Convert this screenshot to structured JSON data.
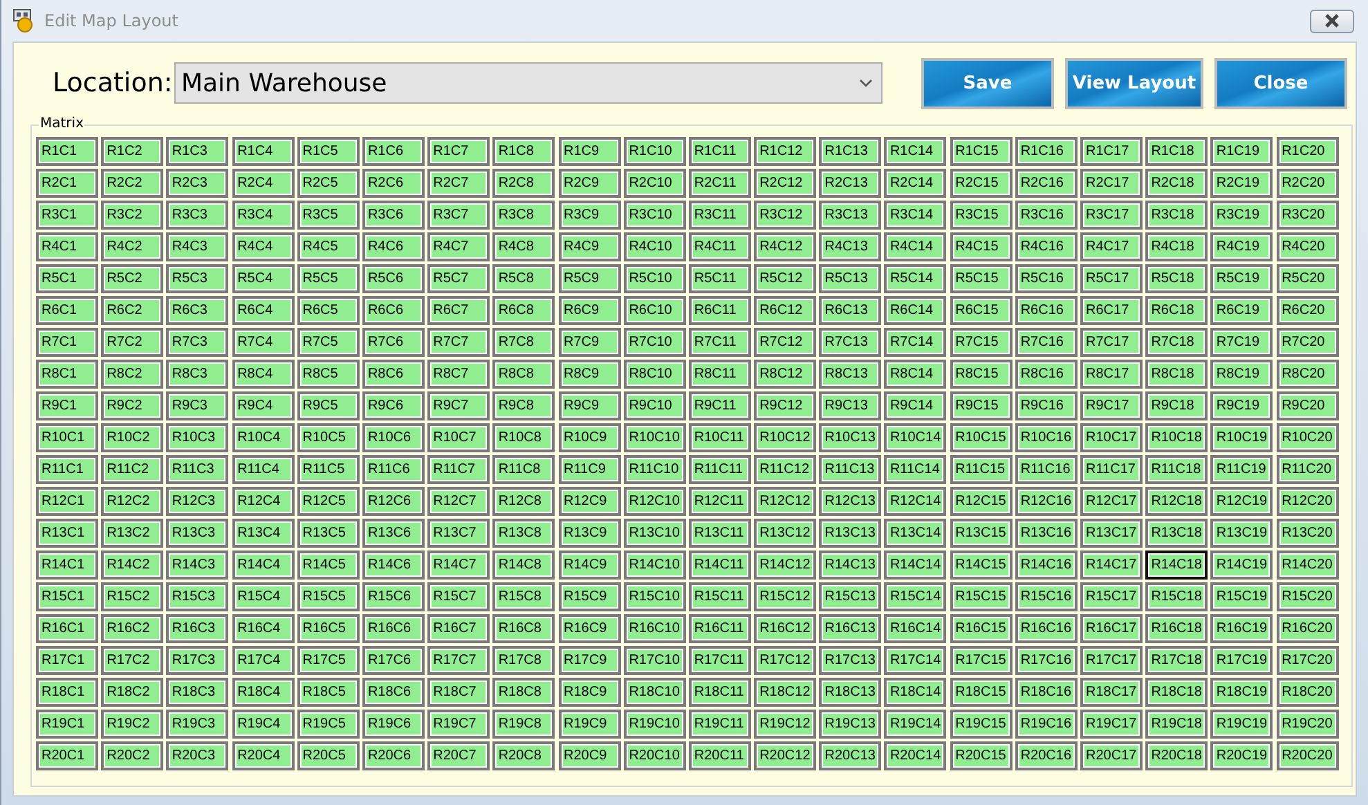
{
  "window": {
    "title": "Edit Map Layout"
  },
  "location": {
    "label": "Location:",
    "value": "Main Warehouse"
  },
  "buttons": [
    "Save",
    "View Layout",
    "Close"
  ],
  "matrix": {
    "title": "Matrix",
    "rows": [
      {
        "cells": [
          {
            "label": "R1C1",
            "focused": false
          },
          {
            "label": "R1C2",
            "focused": false
          },
          {
            "label": "R1C3",
            "focused": false
          },
          {
            "label": "R1C4",
            "focused": false
          },
          {
            "label": "R1C5",
            "focused": false
          },
          {
            "label": "R1C6",
            "focused": false
          },
          {
            "label": "R1C7",
            "focused": false
          },
          {
            "label": "R1C8",
            "focused": false
          },
          {
            "label": "R1C9",
            "focused": false
          },
          {
            "label": "R1C10",
            "focused": false
          },
          {
            "label": "R1C11",
            "focused": false
          },
          {
            "label": "R1C12",
            "focused": false
          },
          {
            "label": "R1C13",
            "focused": false
          },
          {
            "label": "R1C14",
            "focused": false
          },
          {
            "label": "R1C15",
            "focused": false
          },
          {
            "label": "R1C16",
            "focused": false
          },
          {
            "label": "R1C17",
            "focused": false
          },
          {
            "label": "R1C18",
            "focused": false
          },
          {
            "label": "R1C19",
            "focused": false
          },
          {
            "label": "R1C20",
            "focused": false
          }
        ]
      },
      {
        "cells": [
          {
            "label": "R2C1",
            "focused": false
          },
          {
            "label": "R2C2",
            "focused": false
          },
          {
            "label": "R2C3",
            "focused": false
          },
          {
            "label": "R2C4",
            "focused": false
          },
          {
            "label": "R2C5",
            "focused": false
          },
          {
            "label": "R2C6",
            "focused": false
          },
          {
            "label": "R2C7",
            "focused": false
          },
          {
            "label": "R2C8",
            "focused": false
          },
          {
            "label": "R2C9",
            "focused": false
          },
          {
            "label": "R2C10",
            "focused": false
          },
          {
            "label": "R2C11",
            "focused": false
          },
          {
            "label": "R2C12",
            "focused": false
          },
          {
            "label": "R2C13",
            "focused": false
          },
          {
            "label": "R2C14",
            "focused": false
          },
          {
            "label": "R2C15",
            "focused": false
          },
          {
            "label": "R2C16",
            "focused": false
          },
          {
            "label": "R2C17",
            "focused": false
          },
          {
            "label": "R2C18",
            "focused": false
          },
          {
            "label": "R2C19",
            "focused": false
          },
          {
            "label": "R2C20",
            "focused": false
          }
        ]
      },
      {
        "cells": [
          {
            "label": "R3C1",
            "focused": false
          },
          {
            "label": "R3C2",
            "focused": false
          },
          {
            "label": "R3C3",
            "focused": false
          },
          {
            "label": "R3C4",
            "focused": false
          },
          {
            "label": "R3C5",
            "focused": false
          },
          {
            "label": "R3C6",
            "focused": false
          },
          {
            "label": "R3C7",
            "focused": false
          },
          {
            "label": "R3C8",
            "focused": false
          },
          {
            "label": "R3C9",
            "focused": false
          },
          {
            "label": "R3C10",
            "focused": false
          },
          {
            "label": "R3C11",
            "focused": false
          },
          {
            "label": "R3C12",
            "focused": false
          },
          {
            "label": "R3C13",
            "focused": false
          },
          {
            "label": "R3C14",
            "focused": false
          },
          {
            "label": "R3C15",
            "focused": false
          },
          {
            "label": "R3C16",
            "focused": false
          },
          {
            "label": "R3C17",
            "focused": false
          },
          {
            "label": "R3C18",
            "focused": false
          },
          {
            "label": "R3C19",
            "focused": false
          },
          {
            "label": "R3C20",
            "focused": false
          }
        ]
      },
      {
        "cells": [
          {
            "label": "R4C1",
            "focused": false
          },
          {
            "label": "R4C2",
            "focused": false
          },
          {
            "label": "R4C3",
            "focused": false
          },
          {
            "label": "R4C4",
            "focused": false
          },
          {
            "label": "R4C5",
            "focused": false
          },
          {
            "label": "R4C6",
            "focused": false
          },
          {
            "label": "R4C7",
            "focused": false
          },
          {
            "label": "R4C8",
            "focused": false
          },
          {
            "label": "R4C9",
            "focused": false
          },
          {
            "label": "R4C10",
            "focused": false
          },
          {
            "label": "R4C11",
            "focused": false
          },
          {
            "label": "R4C12",
            "focused": false
          },
          {
            "label": "R4C13",
            "focused": false
          },
          {
            "label": "R4C14",
            "focused": false
          },
          {
            "label": "R4C15",
            "focused": false
          },
          {
            "label": "R4C16",
            "focused": false
          },
          {
            "label": "R4C17",
            "focused": false
          },
          {
            "label": "R4C18",
            "focused": false
          },
          {
            "label": "R4C19",
            "focused": false
          },
          {
            "label": "R4C20",
            "focused": false
          }
        ]
      },
      {
        "cells": [
          {
            "label": "R5C1",
            "focused": false
          },
          {
            "label": "R5C2",
            "focused": false
          },
          {
            "label": "R5C3",
            "focused": false
          },
          {
            "label": "R5C4",
            "focused": false
          },
          {
            "label": "R5C5",
            "focused": false
          },
          {
            "label": "R5C6",
            "focused": false
          },
          {
            "label": "R5C7",
            "focused": false
          },
          {
            "label": "R5C8",
            "focused": false
          },
          {
            "label": "R5C9",
            "focused": false
          },
          {
            "label": "R5C10",
            "focused": false
          },
          {
            "label": "R5C11",
            "focused": false
          },
          {
            "label": "R5C12",
            "focused": false
          },
          {
            "label": "R5C13",
            "focused": false
          },
          {
            "label": "R5C14",
            "focused": false
          },
          {
            "label": "R5C15",
            "focused": false
          },
          {
            "label": "R5C16",
            "focused": false
          },
          {
            "label": "R5C17",
            "focused": false
          },
          {
            "label": "R5C18",
            "focused": false
          },
          {
            "label": "R5C19",
            "focused": false
          },
          {
            "label": "R5C20",
            "focused": false
          }
        ]
      },
      {
        "cells": [
          {
            "label": "R6C1",
            "focused": false
          },
          {
            "label": "R6C2",
            "focused": false
          },
          {
            "label": "R6C3",
            "focused": false
          },
          {
            "label": "R6C4",
            "focused": false
          },
          {
            "label": "R6C5",
            "focused": false
          },
          {
            "label": "R6C6",
            "focused": false
          },
          {
            "label": "R6C7",
            "focused": false
          },
          {
            "label": "R6C8",
            "focused": false
          },
          {
            "label": "R6C9",
            "focused": false
          },
          {
            "label": "R6C10",
            "focused": false
          },
          {
            "label": "R6C11",
            "focused": false
          },
          {
            "label": "R6C12",
            "focused": false
          },
          {
            "label": "R6C13",
            "focused": false
          },
          {
            "label": "R6C14",
            "focused": false
          },
          {
            "label": "R6C15",
            "focused": false
          },
          {
            "label": "R6C16",
            "focused": false
          },
          {
            "label": "R6C17",
            "focused": false
          },
          {
            "label": "R6C18",
            "focused": false
          },
          {
            "label": "R6C19",
            "focused": false
          },
          {
            "label": "R6C20",
            "focused": false
          }
        ]
      },
      {
        "cells": [
          {
            "label": "R7C1",
            "focused": false
          },
          {
            "label": "R7C2",
            "focused": false
          },
          {
            "label": "R7C3",
            "focused": false
          },
          {
            "label": "R7C4",
            "focused": false
          },
          {
            "label": "R7C5",
            "focused": false
          },
          {
            "label": "R7C6",
            "focused": false
          },
          {
            "label": "R7C7",
            "focused": false
          },
          {
            "label": "R7C8",
            "focused": false
          },
          {
            "label": "R7C9",
            "focused": false
          },
          {
            "label": "R7C10",
            "focused": false
          },
          {
            "label": "R7C11",
            "focused": false
          },
          {
            "label": "R7C12",
            "focused": false
          },
          {
            "label": "R7C13",
            "focused": false
          },
          {
            "label": "R7C14",
            "focused": false
          },
          {
            "label": "R7C15",
            "focused": false
          },
          {
            "label": "R7C16",
            "focused": false
          },
          {
            "label": "R7C17",
            "focused": false
          },
          {
            "label": "R7C18",
            "focused": false
          },
          {
            "label": "R7C19",
            "focused": false
          },
          {
            "label": "R7C20",
            "focused": false
          }
        ]
      },
      {
        "cells": [
          {
            "label": "R8C1",
            "focused": false
          },
          {
            "label": "R8C2",
            "focused": false
          },
          {
            "label": "R8C3",
            "focused": false
          },
          {
            "label": "R8C4",
            "focused": false
          },
          {
            "label": "R8C5",
            "focused": false
          },
          {
            "label": "R8C6",
            "focused": false
          },
          {
            "label": "R8C7",
            "focused": false
          },
          {
            "label": "R8C8",
            "focused": false
          },
          {
            "label": "R8C9",
            "focused": false
          },
          {
            "label": "R8C10",
            "focused": false
          },
          {
            "label": "R8C11",
            "focused": false
          },
          {
            "label": "R8C12",
            "focused": false
          },
          {
            "label": "R8C13",
            "focused": false
          },
          {
            "label": "R8C14",
            "focused": false
          },
          {
            "label": "R8C15",
            "focused": false
          },
          {
            "label": "R8C16",
            "focused": false
          },
          {
            "label": "R8C17",
            "focused": false
          },
          {
            "label": "R8C18",
            "focused": false
          },
          {
            "label": "R8C19",
            "focused": false
          },
          {
            "label": "R8C20",
            "focused": false
          }
        ]
      },
      {
        "cells": [
          {
            "label": "R9C1",
            "focused": false
          },
          {
            "label": "R9C2",
            "focused": false
          },
          {
            "label": "R9C3",
            "focused": false
          },
          {
            "label": "R9C4",
            "focused": false
          },
          {
            "label": "R9C5",
            "focused": false
          },
          {
            "label": "R9C6",
            "focused": false
          },
          {
            "label": "R9C7",
            "focused": false
          },
          {
            "label": "R9C8",
            "focused": false
          },
          {
            "label": "R9C9",
            "focused": false
          },
          {
            "label": "R9C10",
            "focused": false
          },
          {
            "label": "R9C11",
            "focused": false
          },
          {
            "label": "R9C12",
            "focused": false
          },
          {
            "label": "R9C13",
            "focused": false
          },
          {
            "label": "R9C14",
            "focused": false
          },
          {
            "label": "R9C15",
            "focused": false
          },
          {
            "label": "R9C16",
            "focused": false
          },
          {
            "label": "R9C17",
            "focused": false
          },
          {
            "label": "R9C18",
            "focused": false
          },
          {
            "label": "R9C19",
            "focused": false
          },
          {
            "label": "R9C20",
            "focused": false
          }
        ]
      },
      {
        "cells": [
          {
            "label": "R10C1",
            "focused": false
          },
          {
            "label": "R10C2",
            "focused": false
          },
          {
            "label": "R10C3",
            "focused": false
          },
          {
            "label": "R10C4",
            "focused": false
          },
          {
            "label": "R10C5",
            "focused": false
          },
          {
            "label": "R10C6",
            "focused": false
          },
          {
            "label": "R10C7",
            "focused": false
          },
          {
            "label": "R10C8",
            "focused": false
          },
          {
            "label": "R10C9",
            "focused": false
          },
          {
            "label": "R10C10",
            "focused": false
          },
          {
            "label": "R10C11",
            "focused": false
          },
          {
            "label": "R10C12",
            "focused": false
          },
          {
            "label": "R10C13",
            "focused": false
          },
          {
            "label": "R10C14",
            "focused": false
          },
          {
            "label": "R10C15",
            "focused": false
          },
          {
            "label": "R10C16",
            "focused": false
          },
          {
            "label": "R10C17",
            "focused": false
          },
          {
            "label": "R10C18",
            "focused": false
          },
          {
            "label": "R10C19",
            "focused": false
          },
          {
            "label": "R10C20",
            "focused": false
          }
        ]
      },
      {
        "cells": [
          {
            "label": "R11C1",
            "focused": false
          },
          {
            "label": "R11C2",
            "focused": false
          },
          {
            "label": "R11C3",
            "focused": false
          },
          {
            "label": "R11C4",
            "focused": false
          },
          {
            "label": "R11C5",
            "focused": false
          },
          {
            "label": "R11C6",
            "focused": false
          },
          {
            "label": "R11C7",
            "focused": false
          },
          {
            "label": "R11C8",
            "focused": false
          },
          {
            "label": "R11C9",
            "focused": false
          },
          {
            "label": "R11C10",
            "focused": false
          },
          {
            "label": "R11C11",
            "focused": false
          },
          {
            "label": "R11C12",
            "focused": false
          },
          {
            "label": "R11C13",
            "focused": false
          },
          {
            "label": "R11C14",
            "focused": false
          },
          {
            "label": "R11C15",
            "focused": false
          },
          {
            "label": "R11C16",
            "focused": false
          },
          {
            "label": "R11C17",
            "focused": false
          },
          {
            "label": "R11C18",
            "focused": false
          },
          {
            "label": "R11C19",
            "focused": false
          },
          {
            "label": "R11C20",
            "focused": false
          }
        ]
      },
      {
        "cells": [
          {
            "label": "R12C1",
            "focused": false
          },
          {
            "label": "R12C2",
            "focused": false
          },
          {
            "label": "R12C3",
            "focused": false
          },
          {
            "label": "R12C4",
            "focused": false
          },
          {
            "label": "R12C5",
            "focused": false
          },
          {
            "label": "R12C6",
            "focused": false
          },
          {
            "label": "R12C7",
            "focused": false
          },
          {
            "label": "R12C8",
            "focused": false
          },
          {
            "label": "R12C9",
            "focused": false
          },
          {
            "label": "R12C10",
            "focused": false
          },
          {
            "label": "R12C11",
            "focused": false
          },
          {
            "label": "R12C12",
            "focused": false
          },
          {
            "label": "R12C13",
            "focused": false
          },
          {
            "label": "R12C14",
            "focused": false
          },
          {
            "label": "R12C15",
            "focused": false
          },
          {
            "label": "R12C16",
            "focused": false
          },
          {
            "label": "R12C17",
            "focused": false
          },
          {
            "label": "R12C18",
            "focused": false
          },
          {
            "label": "R12C19",
            "focused": false
          },
          {
            "label": "R12C20",
            "focused": false
          }
        ]
      },
      {
        "cells": [
          {
            "label": "R13C1",
            "focused": false
          },
          {
            "label": "R13C2",
            "focused": false
          },
          {
            "label": "R13C3",
            "focused": false
          },
          {
            "label": "R13C4",
            "focused": false
          },
          {
            "label": "R13C5",
            "focused": false
          },
          {
            "label": "R13C6",
            "focused": false
          },
          {
            "label": "R13C7",
            "focused": false
          },
          {
            "label": "R13C8",
            "focused": false
          },
          {
            "label": "R13C9",
            "focused": false
          },
          {
            "label": "R13C10",
            "focused": false
          },
          {
            "label": "R13C11",
            "focused": false
          },
          {
            "label": "R13C12",
            "focused": false
          },
          {
            "label": "R13C13",
            "focused": false
          },
          {
            "label": "R13C14",
            "focused": false
          },
          {
            "label": "R13C15",
            "focused": false
          },
          {
            "label": "R13C16",
            "focused": false
          },
          {
            "label": "R13C17",
            "focused": false
          },
          {
            "label": "R13C18",
            "focused": false
          },
          {
            "label": "R13C19",
            "focused": false
          },
          {
            "label": "R13C20",
            "focused": false
          }
        ]
      },
      {
        "cells": [
          {
            "label": "R14C1",
            "focused": false
          },
          {
            "label": "R14C2",
            "focused": false
          },
          {
            "label": "R14C3",
            "focused": false
          },
          {
            "label": "R14C4",
            "focused": false
          },
          {
            "label": "R14C5",
            "focused": false
          },
          {
            "label": "R14C6",
            "focused": false
          },
          {
            "label": "R14C7",
            "focused": false
          },
          {
            "label": "R14C8",
            "focused": false
          },
          {
            "label": "R14C9",
            "focused": false
          },
          {
            "label": "R14C10",
            "focused": false
          },
          {
            "label": "R14C11",
            "focused": false
          },
          {
            "label": "R14C12",
            "focused": false
          },
          {
            "label": "R14C13",
            "focused": false
          },
          {
            "label": "R14C14",
            "focused": false
          },
          {
            "label": "R14C15",
            "focused": false
          },
          {
            "label": "R14C16",
            "focused": false
          },
          {
            "label": "R14C17",
            "focused": false
          },
          {
            "label": "R14C18",
            "focused": true
          },
          {
            "label": "R14C19",
            "focused": false
          },
          {
            "label": "R14C20",
            "focused": false
          }
        ]
      },
      {
        "cells": [
          {
            "label": "R15C1",
            "focused": false
          },
          {
            "label": "R15C2",
            "focused": false
          },
          {
            "label": "R15C3",
            "focused": false
          },
          {
            "label": "R15C4",
            "focused": false
          },
          {
            "label": "R15C5",
            "focused": false
          },
          {
            "label": "R15C6",
            "focused": false
          },
          {
            "label": "R15C7",
            "focused": false
          },
          {
            "label": "R15C8",
            "focused": false
          },
          {
            "label": "R15C9",
            "focused": false
          },
          {
            "label": "R15C10",
            "focused": false
          },
          {
            "label": "R15C11",
            "focused": false
          },
          {
            "label": "R15C12",
            "focused": false
          },
          {
            "label": "R15C13",
            "focused": false
          },
          {
            "label": "R15C14",
            "focused": false
          },
          {
            "label": "R15C15",
            "focused": false
          },
          {
            "label": "R15C16",
            "focused": false
          },
          {
            "label": "R15C17",
            "focused": false
          },
          {
            "label": "R15C18",
            "focused": false
          },
          {
            "label": "R15C19",
            "focused": false
          },
          {
            "label": "R15C20",
            "focused": false
          }
        ]
      },
      {
        "cells": [
          {
            "label": "R16C1",
            "focused": false
          },
          {
            "label": "R16C2",
            "focused": false
          },
          {
            "label": "R16C3",
            "focused": false
          },
          {
            "label": "R16C4",
            "focused": false
          },
          {
            "label": "R16C5",
            "focused": false
          },
          {
            "label": "R16C6",
            "focused": false
          },
          {
            "label": "R16C7",
            "focused": false
          },
          {
            "label": "R16C8",
            "focused": false
          },
          {
            "label": "R16C9",
            "focused": false
          },
          {
            "label": "R16C10",
            "focused": false
          },
          {
            "label": "R16C11",
            "focused": false
          },
          {
            "label": "R16C12",
            "focused": false
          },
          {
            "label": "R16C13",
            "focused": false
          },
          {
            "label": "R16C14",
            "focused": false
          },
          {
            "label": "R16C15",
            "focused": false
          },
          {
            "label": "R16C16",
            "focused": false
          },
          {
            "label": "R16C17",
            "focused": false
          },
          {
            "label": "R16C18",
            "focused": false
          },
          {
            "label": "R16C19",
            "focused": false
          },
          {
            "label": "R16C20",
            "focused": false
          }
        ]
      },
      {
        "cells": [
          {
            "label": "R17C1",
            "focused": false
          },
          {
            "label": "R17C2",
            "focused": false
          },
          {
            "label": "R17C3",
            "focused": false
          },
          {
            "label": "R17C4",
            "focused": false
          },
          {
            "label": "R17C5",
            "focused": false
          },
          {
            "label": "R17C6",
            "focused": false
          },
          {
            "label": "R17C7",
            "focused": false
          },
          {
            "label": "R17C8",
            "focused": false
          },
          {
            "label": "R17C9",
            "focused": false
          },
          {
            "label": "R17C10",
            "focused": false
          },
          {
            "label": "R17C11",
            "focused": false
          },
          {
            "label": "R17C12",
            "focused": false
          },
          {
            "label": "R17C13",
            "focused": false
          },
          {
            "label": "R17C14",
            "focused": false
          },
          {
            "label": "R17C15",
            "focused": false
          },
          {
            "label": "R17C16",
            "focused": false
          },
          {
            "label": "R17C17",
            "focused": false
          },
          {
            "label": "R17C18",
            "focused": false
          },
          {
            "label": "R17C19",
            "focused": false
          },
          {
            "label": "R17C20",
            "focused": false
          }
        ]
      },
      {
        "cells": [
          {
            "label": "R18C1",
            "focused": false
          },
          {
            "label": "R18C2",
            "focused": false
          },
          {
            "label": "R18C3",
            "focused": false
          },
          {
            "label": "R18C4",
            "focused": false
          },
          {
            "label": "R18C5",
            "focused": false
          },
          {
            "label": "R18C6",
            "focused": false
          },
          {
            "label": "R18C7",
            "focused": false
          },
          {
            "label": "R18C8",
            "focused": false
          },
          {
            "label": "R18C9",
            "focused": false
          },
          {
            "label": "R18C10",
            "focused": false
          },
          {
            "label": "R18C11",
            "focused": false
          },
          {
            "label": "R18C12",
            "focused": false
          },
          {
            "label": "R18C13",
            "focused": false
          },
          {
            "label": "R18C14",
            "focused": false
          },
          {
            "label": "R18C15",
            "focused": false
          },
          {
            "label": "R18C16",
            "focused": false
          },
          {
            "label": "R18C17",
            "focused": false
          },
          {
            "label": "R18C18",
            "focused": false
          },
          {
            "label": "R18C19",
            "focused": false
          },
          {
            "label": "R18C20",
            "focused": false
          }
        ]
      },
      {
        "cells": [
          {
            "label": "R19C1",
            "focused": false
          },
          {
            "label": "R19C2",
            "focused": false
          },
          {
            "label": "R19C3",
            "focused": false
          },
          {
            "label": "R19C4",
            "focused": false
          },
          {
            "label": "R19C5",
            "focused": false
          },
          {
            "label": "R19C6",
            "focused": false
          },
          {
            "label": "R19C7",
            "focused": false
          },
          {
            "label": "R19C8",
            "focused": false
          },
          {
            "label": "R19C9",
            "focused": false
          },
          {
            "label": "R19C10",
            "focused": false
          },
          {
            "label": "R19C11",
            "focused": false
          },
          {
            "label": "R19C12",
            "focused": false
          },
          {
            "label": "R19C13",
            "focused": false
          },
          {
            "label": "R19C14",
            "focused": false
          },
          {
            "label": "R19C15",
            "focused": false
          },
          {
            "label": "R19C16",
            "focused": false
          },
          {
            "label": "R19C17",
            "focused": false
          },
          {
            "label": "R19C18",
            "focused": false
          },
          {
            "label": "R19C19",
            "focused": false
          },
          {
            "label": "R19C20",
            "focused": false
          }
        ]
      },
      {
        "cells": [
          {
            "label": "R20C1",
            "focused": false
          },
          {
            "label": "R20C2",
            "focused": false
          },
          {
            "label": "R20C3",
            "focused": false
          },
          {
            "label": "R20C4",
            "focused": false
          },
          {
            "label": "R20C5",
            "focused": false
          },
          {
            "label": "R20C6",
            "focused": false
          },
          {
            "label": "R20C7",
            "focused": false
          },
          {
            "label": "R20C8",
            "focused": false
          },
          {
            "label": "R20C9",
            "focused": false
          },
          {
            "label": "R20C10",
            "focused": false
          },
          {
            "label": "R20C11",
            "focused": false
          },
          {
            "label": "R20C12",
            "focused": false
          },
          {
            "label": "R20C13",
            "focused": false
          },
          {
            "label": "R20C14",
            "focused": false
          },
          {
            "label": "R20C15",
            "focused": false
          },
          {
            "label": "R20C16",
            "focused": false
          },
          {
            "label": "R20C17",
            "focused": false
          },
          {
            "label": "R20C18",
            "focused": false
          },
          {
            "label": "R20C19",
            "focused": false
          },
          {
            "label": "R20C20",
            "focused": false
          }
        ]
      }
    ]
  }
}
